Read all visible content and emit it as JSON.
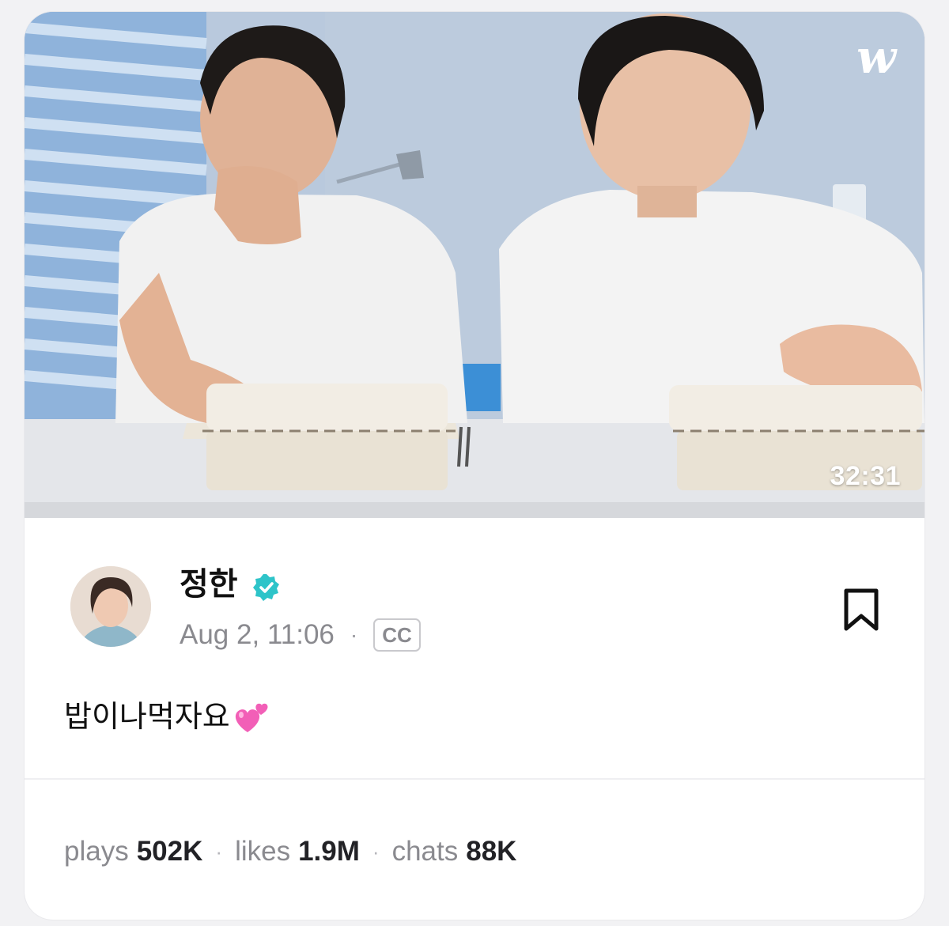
{
  "video": {
    "logo": "w",
    "duration": "32:31"
  },
  "author": {
    "name": "정한",
    "date": "Aug 2, 11:06",
    "separator": "·",
    "cc_label": "CC"
  },
  "post": {
    "caption": "밥이나먹자요"
  },
  "stats": {
    "plays_label": "plays",
    "plays_value": "502K",
    "likes_label": "likes",
    "likes_value": "1.9M",
    "chats_label": "chats",
    "chats_value": "88K",
    "separator": "·"
  },
  "icons": {
    "verified": "verified-badge-icon",
    "bookmark": "bookmark-icon",
    "heart": "two-hearts-emoji"
  },
  "colors": {
    "verified": "#2ec4c9",
    "text_primary": "#111111",
    "text_secondary": "#8a8a8f"
  }
}
